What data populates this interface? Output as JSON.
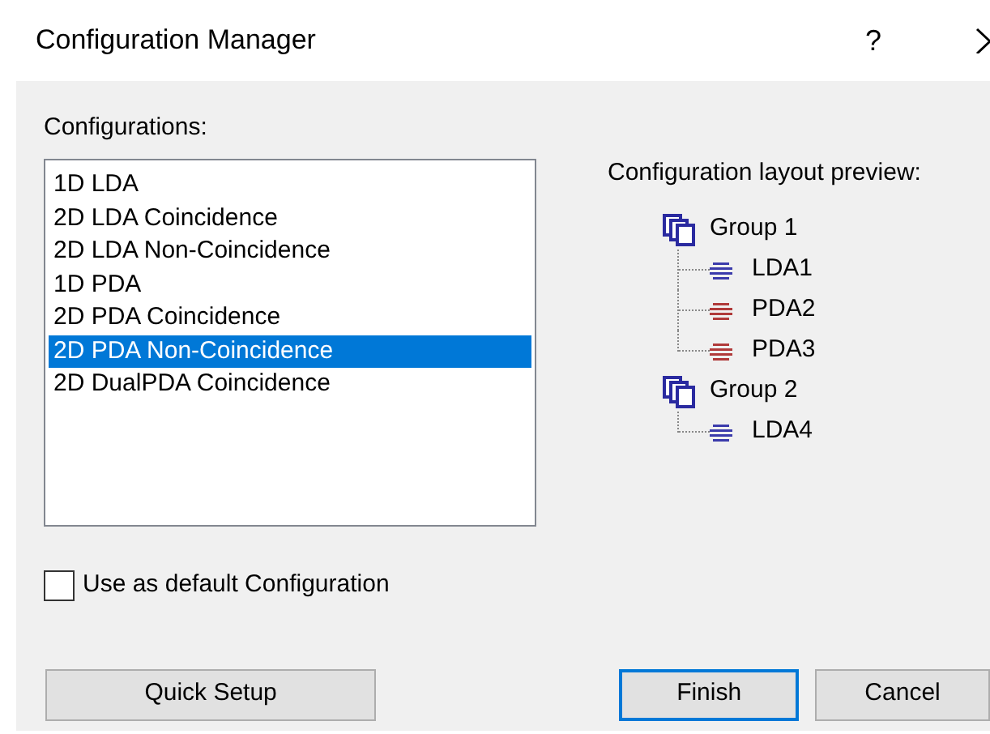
{
  "window": {
    "title": "Configuration Manager",
    "help": "?"
  },
  "configurations": {
    "label": "Configurations:",
    "items": [
      {
        "label": "1D LDA",
        "selected": false
      },
      {
        "label": "2D LDA Coincidence",
        "selected": false
      },
      {
        "label": "2D LDA Non-Coincidence",
        "selected": false
      },
      {
        "label": "1D PDA",
        "selected": false
      },
      {
        "label": "2D PDA Coincidence",
        "selected": false
      },
      {
        "label": "2D PDA Non-Coincidence",
        "selected": true
      },
      {
        "label": "2D DualPDA Coincidence",
        "selected": false
      }
    ]
  },
  "preview": {
    "label": "Configuration layout preview:",
    "tree": [
      {
        "label": "Group 1",
        "children": [
          {
            "label": "LDA1",
            "color": "#3b3bab"
          },
          {
            "label": "PDA2",
            "color": "#b03a3a"
          },
          {
            "label": "PDA3",
            "color": "#b03a3a"
          }
        ]
      },
      {
        "label": "Group 2",
        "children": [
          {
            "label": "LDA4",
            "color": "#3b3bab"
          }
        ]
      }
    ]
  },
  "default_checkbox": {
    "label": "Use as default Configuration",
    "checked": false
  },
  "buttons": [
    {
      "label": "Quick Setup",
      "default": false
    },
    {
      "label": "Finish",
      "default": true
    },
    {
      "label": "Cancel",
      "default": false
    }
  ]
}
